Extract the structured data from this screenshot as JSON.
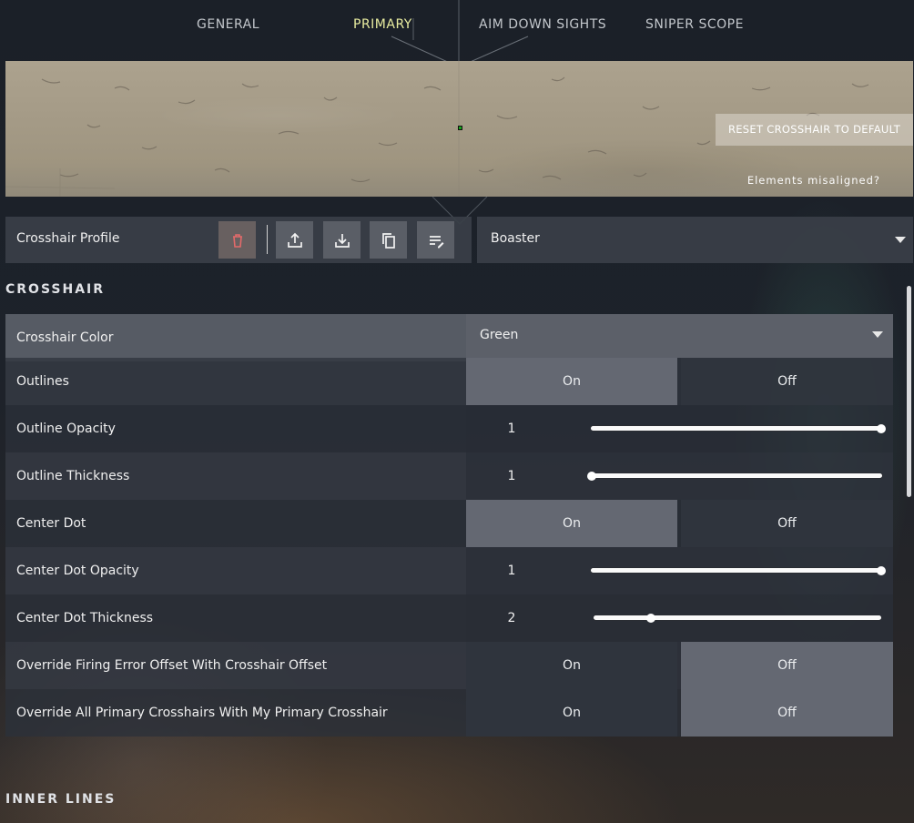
{
  "tabs": [
    {
      "label": "GENERAL",
      "active": false
    },
    {
      "label": "PRIMARY",
      "active": true
    },
    {
      "label": "AIM DOWN SIGHTS",
      "active": false
    },
    {
      "label": "SNIPER SCOPE",
      "active": false
    }
  ],
  "preview": {
    "reset_label": "RESET CROSSHAIR TO DEFAULT",
    "misaligned_text": "Elements misaligned?",
    "crosshair_color": "#16a21a"
  },
  "profile": {
    "label": "Crosshair Profile",
    "selected": "Boaster",
    "buttons": [
      "trash-icon",
      "upload-icon",
      "download-icon",
      "copy-icon",
      "rename-icon"
    ]
  },
  "sections": {
    "crosshair": "CROSSHAIR",
    "inner_lines": "INNER LINES"
  },
  "options": {
    "on": "On",
    "off": "Off"
  },
  "settings": {
    "crosshair_color": {
      "label": "Crosshair Color",
      "value": "Green"
    },
    "outlines": {
      "label": "Outlines",
      "selected": "On"
    },
    "outline_opacity": {
      "label": "Outline Opacity",
      "value": "1",
      "fraction": 1.0
    },
    "outline_thickness": {
      "label": "Outline Thickness",
      "value": "1",
      "fraction": 0.0
    },
    "center_dot": {
      "label": "Center Dot",
      "selected": "On"
    },
    "center_dot_opacity": {
      "label": "Center Dot Opacity",
      "value": "1",
      "fraction": 1.0
    },
    "center_dot_thickness": {
      "label": "Center Dot Thickness",
      "value": "2",
      "fraction": 0.2
    },
    "override_firing_error": {
      "label": "Override Firing Error Offset With Crosshair Offset",
      "selected": "Off"
    },
    "override_primary": {
      "label": "Override All Primary Crosshairs With My Primary Crosshair",
      "selected": "Off"
    }
  }
}
